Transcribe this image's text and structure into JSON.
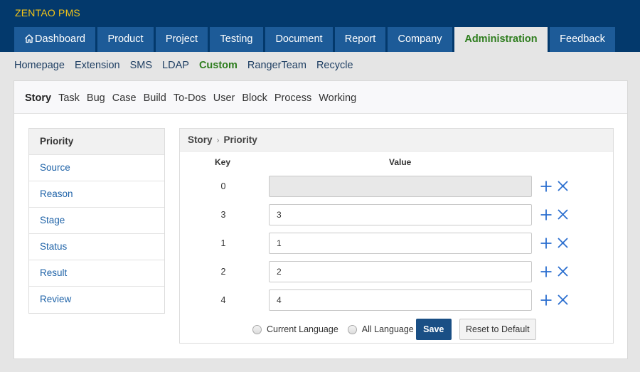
{
  "brand": "ZENTAO PMS",
  "colors": {
    "header_bg": "#03396c",
    "tab_bg": "#1d5b98",
    "active_green": "#2e7d1e",
    "brand_yellow": "#f5c518",
    "link_blue": "#1f63a8",
    "save_bg": "#1a4f85",
    "icon_blue": "#2b6fcf"
  },
  "main_nav": [
    {
      "label": "Dashboard",
      "icon": "home-icon"
    },
    {
      "label": "Product"
    },
    {
      "label": "Project"
    },
    {
      "label": "Testing"
    },
    {
      "label": "Document"
    },
    {
      "label": "Report"
    },
    {
      "label": "Company"
    },
    {
      "label": "Administration",
      "active": true
    },
    {
      "label": "Feedback"
    }
  ],
  "sub_nav": [
    {
      "label": "Homepage"
    },
    {
      "label": "Extension"
    },
    {
      "label": "SMS"
    },
    {
      "label": "LDAP"
    },
    {
      "label": "Custom",
      "active": true
    },
    {
      "label": "RangerTeam"
    },
    {
      "label": "Recycle"
    }
  ],
  "module_tabs": [
    {
      "label": "Story",
      "active": true
    },
    {
      "label": "Task"
    },
    {
      "label": "Bug"
    },
    {
      "label": "Case"
    },
    {
      "label": "Build"
    },
    {
      "label": "To-Dos"
    },
    {
      "label": "User"
    },
    {
      "label": "Block"
    },
    {
      "label": "Process"
    },
    {
      "label": "Working"
    }
  ],
  "side_list": [
    {
      "label": "Priority",
      "active": true
    },
    {
      "label": "Source"
    },
    {
      "label": "Reason"
    },
    {
      "label": "Stage"
    },
    {
      "label": "Status"
    },
    {
      "label": "Result"
    },
    {
      "label": "Review"
    }
  ],
  "breadcrumb": {
    "module": "Story",
    "separator": "›",
    "field": "Priority"
  },
  "table": {
    "key_header": "Key",
    "value_header": "Value",
    "rows": [
      {
        "key": "0",
        "value": "",
        "readonly": true
      },
      {
        "key": "3",
        "value": "3"
      },
      {
        "key": "1",
        "value": "1"
      },
      {
        "key": "2",
        "value": "2"
      },
      {
        "key": "4",
        "value": "4"
      }
    ]
  },
  "footer": {
    "current_language": "Current Language",
    "all_language": "All Language",
    "save": "Save",
    "reset": "Reset to Default"
  }
}
